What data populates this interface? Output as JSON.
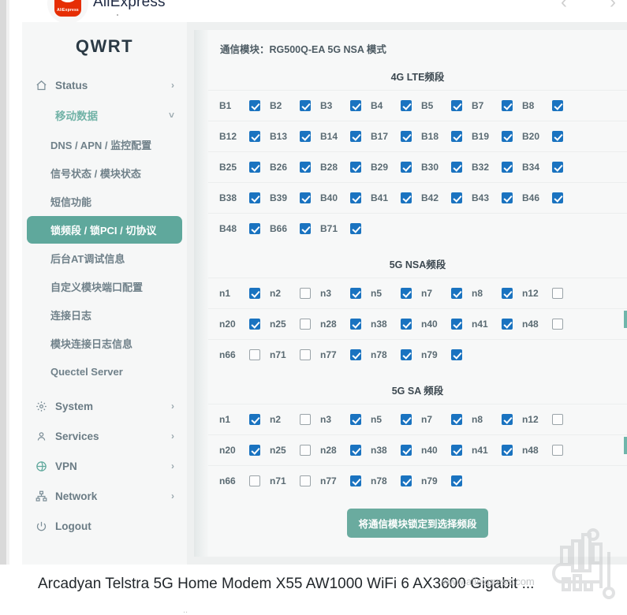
{
  "topbar": {
    "site_name": "AliExpress",
    "logo_word": "AliExpress",
    "prev_icon": "‹",
    "next_icon": "›"
  },
  "sidebar": {
    "brand": "QWRT",
    "items": [
      {
        "label": "Status",
        "icon": "home-icon",
        "chevron": "›",
        "state": "collapsed"
      },
      {
        "label": "移动数据",
        "icon": "none",
        "chevron": "˅",
        "state": "expanded"
      }
    ],
    "sub_items": [
      {
        "label": "DNS / APN / 监控配置",
        "active": false
      },
      {
        "label": "信号状态 / 模块状态",
        "active": false
      },
      {
        "label": "短信功能",
        "active": false
      },
      {
        "label": "锁频段 / 锁PCI / 切协议",
        "active": true
      },
      {
        "label": "后台AT调试信息",
        "active": false
      },
      {
        "label": "自定义模块端口配置",
        "active": false
      },
      {
        "label": "连接日志",
        "active": false
      },
      {
        "label": "模块连接日志信息",
        "active": false
      },
      {
        "label": "Quectel Server",
        "active": false
      }
    ],
    "bottom_items": [
      {
        "label": "System",
        "icon": "gear-icon",
        "chevron": "›"
      },
      {
        "label": "Services",
        "icon": "user-icon",
        "chevron": "›"
      },
      {
        "label": "VPN",
        "icon": "vpn-icon",
        "chevron": "›"
      },
      {
        "label": "Network",
        "icon": "network-icon",
        "chevron": "›"
      },
      {
        "label": "Logout",
        "icon": "power-icon",
        "chevron": ""
      }
    ]
  },
  "content": {
    "module_line": "通信模块：RG500Q-EA 5G NSA 模式",
    "lock_button": "将通信模块锁定到选择频段",
    "sections": [
      {
        "title": "4G LTE频段",
        "rows": [
          [
            {
              "label": "B1",
              "checked": true
            },
            {
              "label": "B2",
              "checked": true
            },
            {
              "label": "B3",
              "checked": true
            },
            {
              "label": "B4",
              "checked": true
            },
            {
              "label": "B5",
              "checked": true
            },
            {
              "label": "B7",
              "checked": true
            },
            {
              "label": "B8",
              "checked": true
            }
          ],
          [
            {
              "label": "B12",
              "checked": true
            },
            {
              "label": "B13",
              "checked": true
            },
            {
              "label": "B14",
              "checked": true
            },
            {
              "label": "B17",
              "checked": true
            },
            {
              "label": "B18",
              "checked": true
            },
            {
              "label": "B19",
              "checked": true
            },
            {
              "label": "B20",
              "checked": true
            }
          ],
          [
            {
              "label": "B25",
              "checked": true
            },
            {
              "label": "B26",
              "checked": true
            },
            {
              "label": "B28",
              "checked": true
            },
            {
              "label": "B29",
              "checked": true
            },
            {
              "label": "B30",
              "checked": true
            },
            {
              "label": "B32",
              "checked": true
            },
            {
              "label": "B34",
              "checked": true
            }
          ],
          [
            {
              "label": "B38",
              "checked": true
            },
            {
              "label": "B39",
              "checked": true
            },
            {
              "label": "B40",
              "checked": true
            },
            {
              "label": "B41",
              "checked": true
            },
            {
              "label": "B42",
              "checked": true
            },
            {
              "label": "B43",
              "checked": true
            },
            {
              "label": "B46",
              "checked": true
            }
          ],
          [
            {
              "label": "B48",
              "checked": true
            },
            {
              "label": "B66",
              "checked": true
            },
            {
              "label": "B71",
              "checked": true
            }
          ]
        ]
      },
      {
        "title": "5G NSA频段",
        "rows": [
          [
            {
              "label": "n1",
              "checked": true
            },
            {
              "label": "n2",
              "checked": false
            },
            {
              "label": "n3",
              "checked": true
            },
            {
              "label": "n5",
              "checked": true
            },
            {
              "label": "n7",
              "checked": true
            },
            {
              "label": "n8",
              "checked": true
            },
            {
              "label": "n12",
              "checked": false
            }
          ],
          [
            {
              "label": "n20",
              "checked": true
            },
            {
              "label": "n25",
              "checked": false
            },
            {
              "label": "n28",
              "checked": true
            },
            {
              "label": "n38",
              "checked": true
            },
            {
              "label": "n40",
              "checked": true
            },
            {
              "label": "n41",
              "checked": true
            },
            {
              "label": "n48",
              "checked": false
            }
          ],
          [
            {
              "label": "n66",
              "checked": false
            },
            {
              "label": "n71",
              "checked": false
            },
            {
              "label": "n77",
              "checked": true
            },
            {
              "label": "n78",
              "checked": true
            },
            {
              "label": "n79",
              "checked": true
            }
          ]
        ]
      },
      {
        "title": "5G SA 频段",
        "rows": [
          [
            {
              "label": "n1",
              "checked": true
            },
            {
              "label": "n2",
              "checked": false
            },
            {
              "label": "n3",
              "checked": true
            },
            {
              "label": "n5",
              "checked": true
            },
            {
              "label": "n7",
              "checked": true
            },
            {
              "label": "n8",
              "checked": true
            },
            {
              "label": "n12",
              "checked": false
            }
          ],
          [
            {
              "label": "n20",
              "checked": true
            },
            {
              "label": "n25",
              "checked": false
            },
            {
              "label": "n28",
              "checked": true
            },
            {
              "label": "n38",
              "checked": true
            },
            {
              "label": "n40",
              "checked": true
            },
            {
              "label": "n41",
              "checked": true
            },
            {
              "label": "n48",
              "checked": false
            }
          ],
          [
            {
              "label": "n66",
              "checked": false
            },
            {
              "label": "n71",
              "checked": false
            },
            {
              "label": "n77",
              "checked": true
            },
            {
              "label": "n78",
              "checked": true
            },
            {
              "label": "n79",
              "checked": true
            }
          ]
        ]
      }
    ]
  },
  "footer": {
    "product_title": "Arcadyan Telstra 5G Home Modem X55 AW1000 WiFi 6 AX3600 Gigabit ...",
    "watermark_text": "www.aliexpress.com"
  },
  "colors": {
    "accent_teal": "#5fa89c",
    "checkbox_blue": "#1a73c0",
    "sidebar_bg": "#f6f7f7",
    "card_bg": "#f7f8f8",
    "brand_red": "#e62e04"
  }
}
